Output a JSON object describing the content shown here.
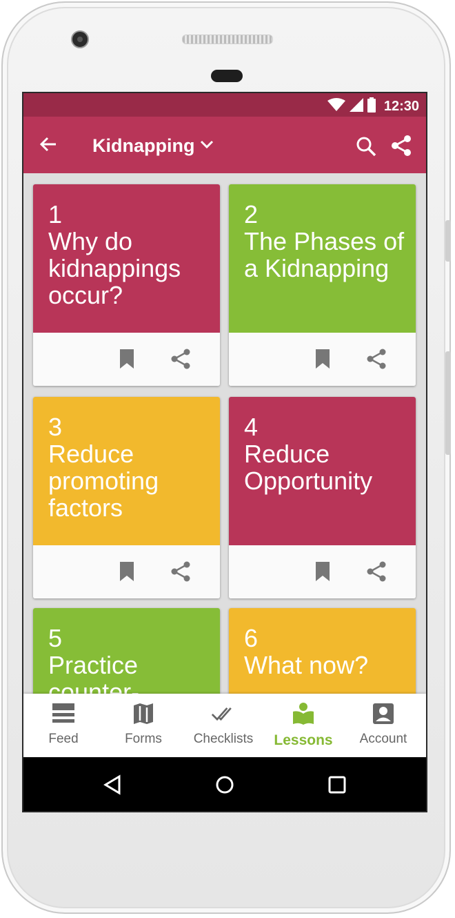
{
  "status_bar": {
    "time": "12:30"
  },
  "app_bar": {
    "title": "Kidnapping"
  },
  "lessons": [
    {
      "number": "1",
      "title": "Why do kidnappings occur?",
      "color": "#b83558"
    },
    {
      "number": "2",
      "title": "The Phases of a Kidnapping",
      "color": "#86bd37"
    },
    {
      "number": "3",
      "title": "Reduce promoting factors",
      "color": "#f2b92d"
    },
    {
      "number": "4",
      "title": "Reduce Opportunity",
      "color": "#b83558"
    },
    {
      "number": "5",
      "title": "Practice counter-",
      "color": "#86bd37"
    },
    {
      "number": "6",
      "title": "What now?",
      "color": "#f2b92d"
    }
  ],
  "bottom_nav": {
    "items": [
      {
        "label": "Feed",
        "icon": "feed-icon"
      },
      {
        "label": "Forms",
        "icon": "map-icon"
      },
      {
        "label": "Checklists",
        "icon": "double-check-icon"
      },
      {
        "label": "Lessons",
        "icon": "book-icon",
        "active": true
      },
      {
        "label": "Account",
        "icon": "account-icon"
      }
    ]
  },
  "colors": {
    "status_bar": "#992a48",
    "app_bar": "#b83558",
    "accent": "#86b934"
  }
}
